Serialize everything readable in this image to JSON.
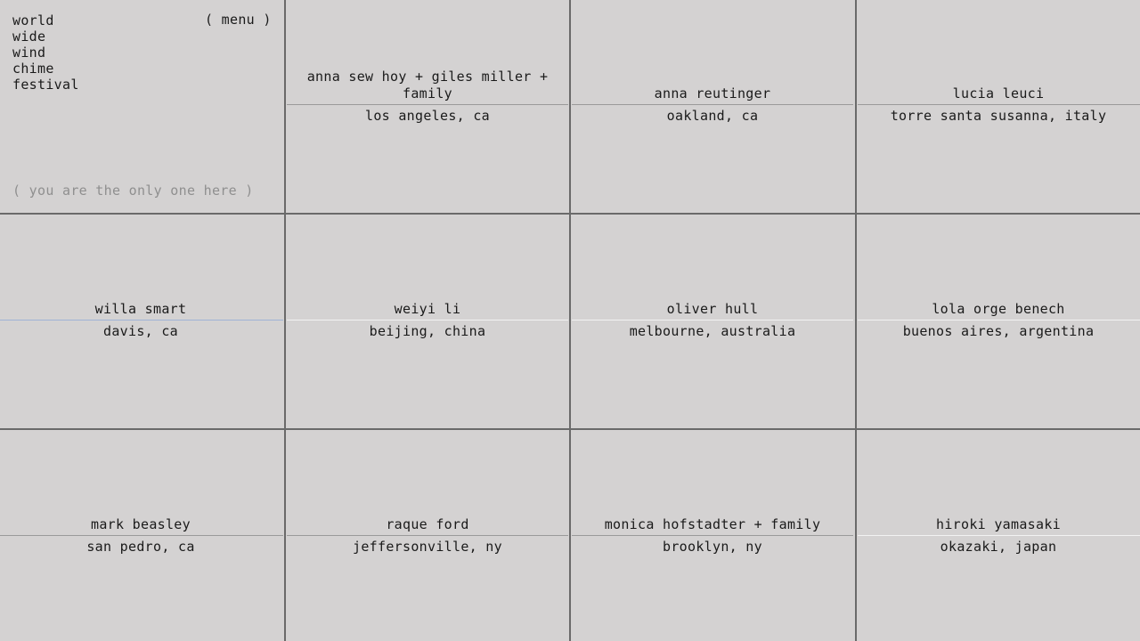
{
  "app": {
    "title_words": [
      "world",
      "wide",
      "wind",
      "chime",
      "festival"
    ],
    "menu_label": "( menu )",
    "status_text": "( you are the only one here )"
  },
  "participants": [
    {
      "name": "anna sew hoy + giles miller + family",
      "place": "los angeles, ca"
    },
    {
      "name": "anna reutinger",
      "place": "oakland, ca"
    },
    {
      "name": "lucia leuci",
      "place": "torre santa susanna, italy"
    },
    {
      "name": "willa smart",
      "place": "davis, ca"
    },
    {
      "name": "weiyi li",
      "place": "beijing, china"
    },
    {
      "name": "oliver hull",
      "place": "melbourne, australia"
    },
    {
      "name": "lola orge benech",
      "place": "buenos aires, argentina"
    },
    {
      "name": "mark beasley",
      "place": "san pedro, ca"
    },
    {
      "name": "raque ford",
      "place": "jeffersonville, ny"
    },
    {
      "name": "monica hofstadter + family",
      "place": "brooklyn, ny"
    },
    {
      "name": "hiroki yamasaki",
      "place": "okazaki, japan"
    }
  ],
  "colors": {
    "background": "#d4d2d2",
    "grid_line": "#6a6a6a",
    "text": "#1a1a1a",
    "muted_text": "#8f8f8f"
  }
}
